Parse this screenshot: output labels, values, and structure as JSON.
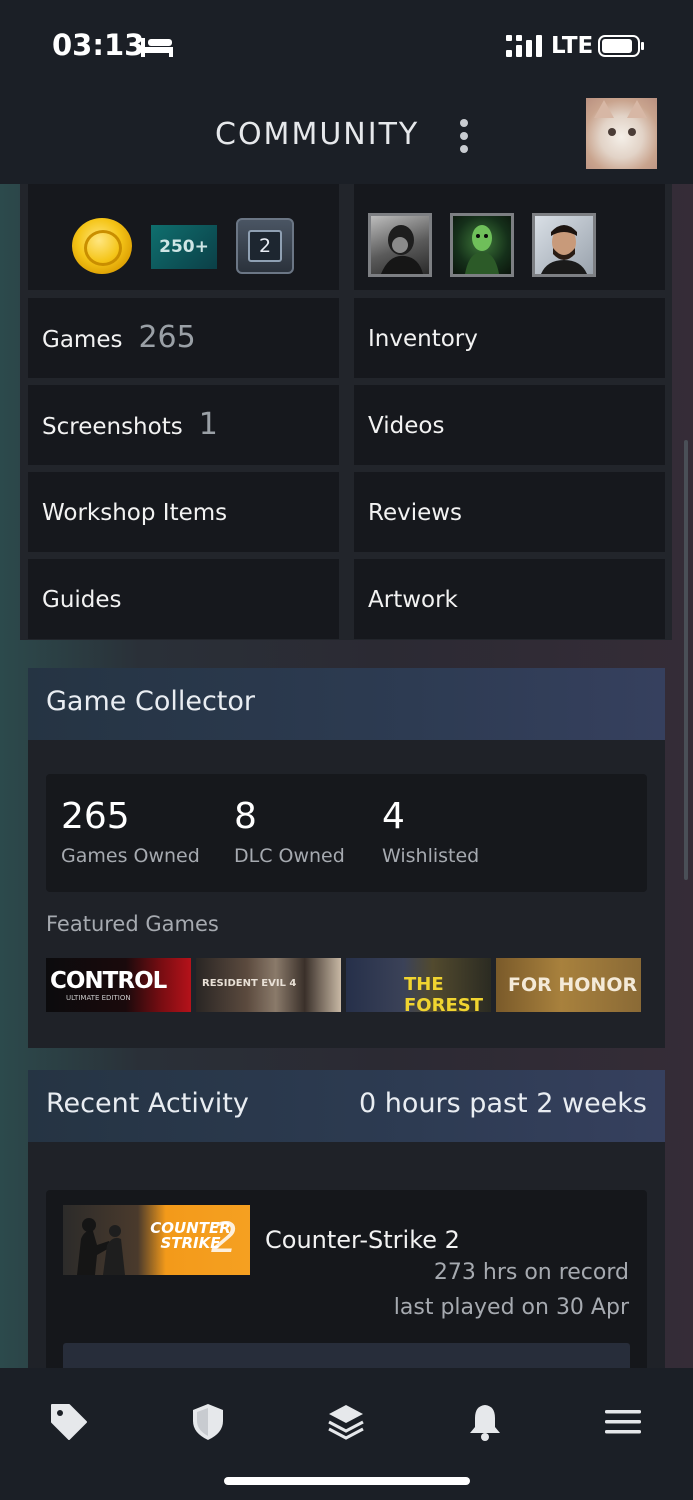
{
  "status_bar": {
    "time": "03:13",
    "network": "LTE"
  },
  "header": {
    "title": "COMMUNITY"
  },
  "badges": {
    "level_250": "250+",
    "level_2": "2"
  },
  "profile_links": [
    {
      "label": "Games",
      "count": "265"
    },
    {
      "label": "Inventory",
      "count": ""
    },
    {
      "label": "Screenshots",
      "count": "1"
    },
    {
      "label": "Videos",
      "count": ""
    },
    {
      "label": "Workshop Items",
      "count": ""
    },
    {
      "label": "Reviews",
      "count": ""
    },
    {
      "label": "Guides",
      "count": ""
    },
    {
      "label": "Artwork",
      "count": ""
    }
  ],
  "game_collector": {
    "title": "Game Collector",
    "stats": [
      {
        "value": "265",
        "label": "Games Owned"
      },
      {
        "value": "8",
        "label": "DLC Owned"
      },
      {
        "value": "4",
        "label": "Wishlisted"
      }
    ],
    "featured_label": "Featured Games",
    "featured_games": [
      {
        "title": "CONTROL",
        "subtitle": "ULTIMATE EDITION"
      },
      {
        "title": "RESIDENT EVIL 4",
        "subtitle": ""
      },
      {
        "title": "THE FOREST",
        "subtitle": ""
      },
      {
        "title": "FOR HONOR",
        "subtitle": ""
      }
    ]
  },
  "recent_activity": {
    "title": "Recent Activity",
    "summary": "0 hours past 2 weeks",
    "game": {
      "name": "Counter-Strike 2",
      "art_text": "COUNTER STRIKE",
      "art_number": "2",
      "hours": "273 hrs on record",
      "last_played": "last played on 30 Apr"
    }
  },
  "tab_bar": [
    "store-tag-icon",
    "shield-icon",
    "layers-icon",
    "bell-icon",
    "hamburger-menu-icon"
  ]
}
